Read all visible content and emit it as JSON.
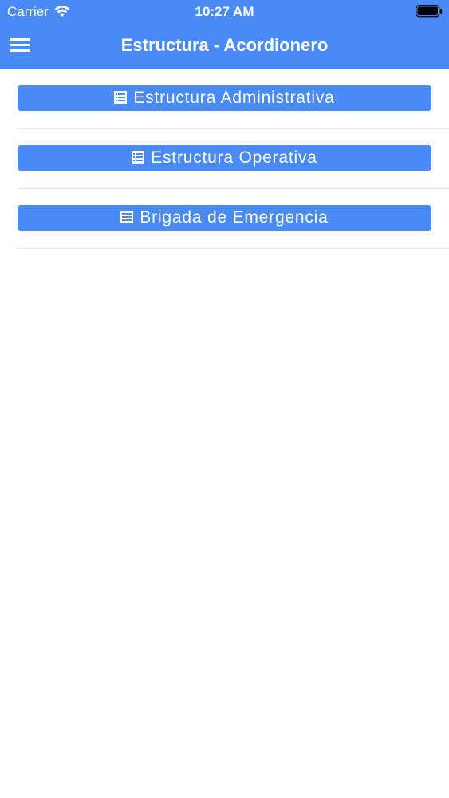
{
  "status_bar": {
    "carrier": "Carrier",
    "time": "10:27 AM",
    "wifi_icon": "wifi-icon",
    "battery_icon": "battery-icon"
  },
  "nav": {
    "title": "Estructura - Acordionero",
    "menu_icon": "hamburger-menu-icon"
  },
  "sections": [
    {
      "label": "Estructura Administrativa",
      "icon": "list-icon"
    },
    {
      "label": "Estructura Operativa",
      "icon": "list-icon"
    },
    {
      "label": "Brigada de Emergencia",
      "icon": "list-icon"
    }
  ],
  "colors": {
    "primary": "#4a8af4",
    "text_on_primary": "#ffffff",
    "divider": "#e3e6ea",
    "background": "#ffffff"
  }
}
